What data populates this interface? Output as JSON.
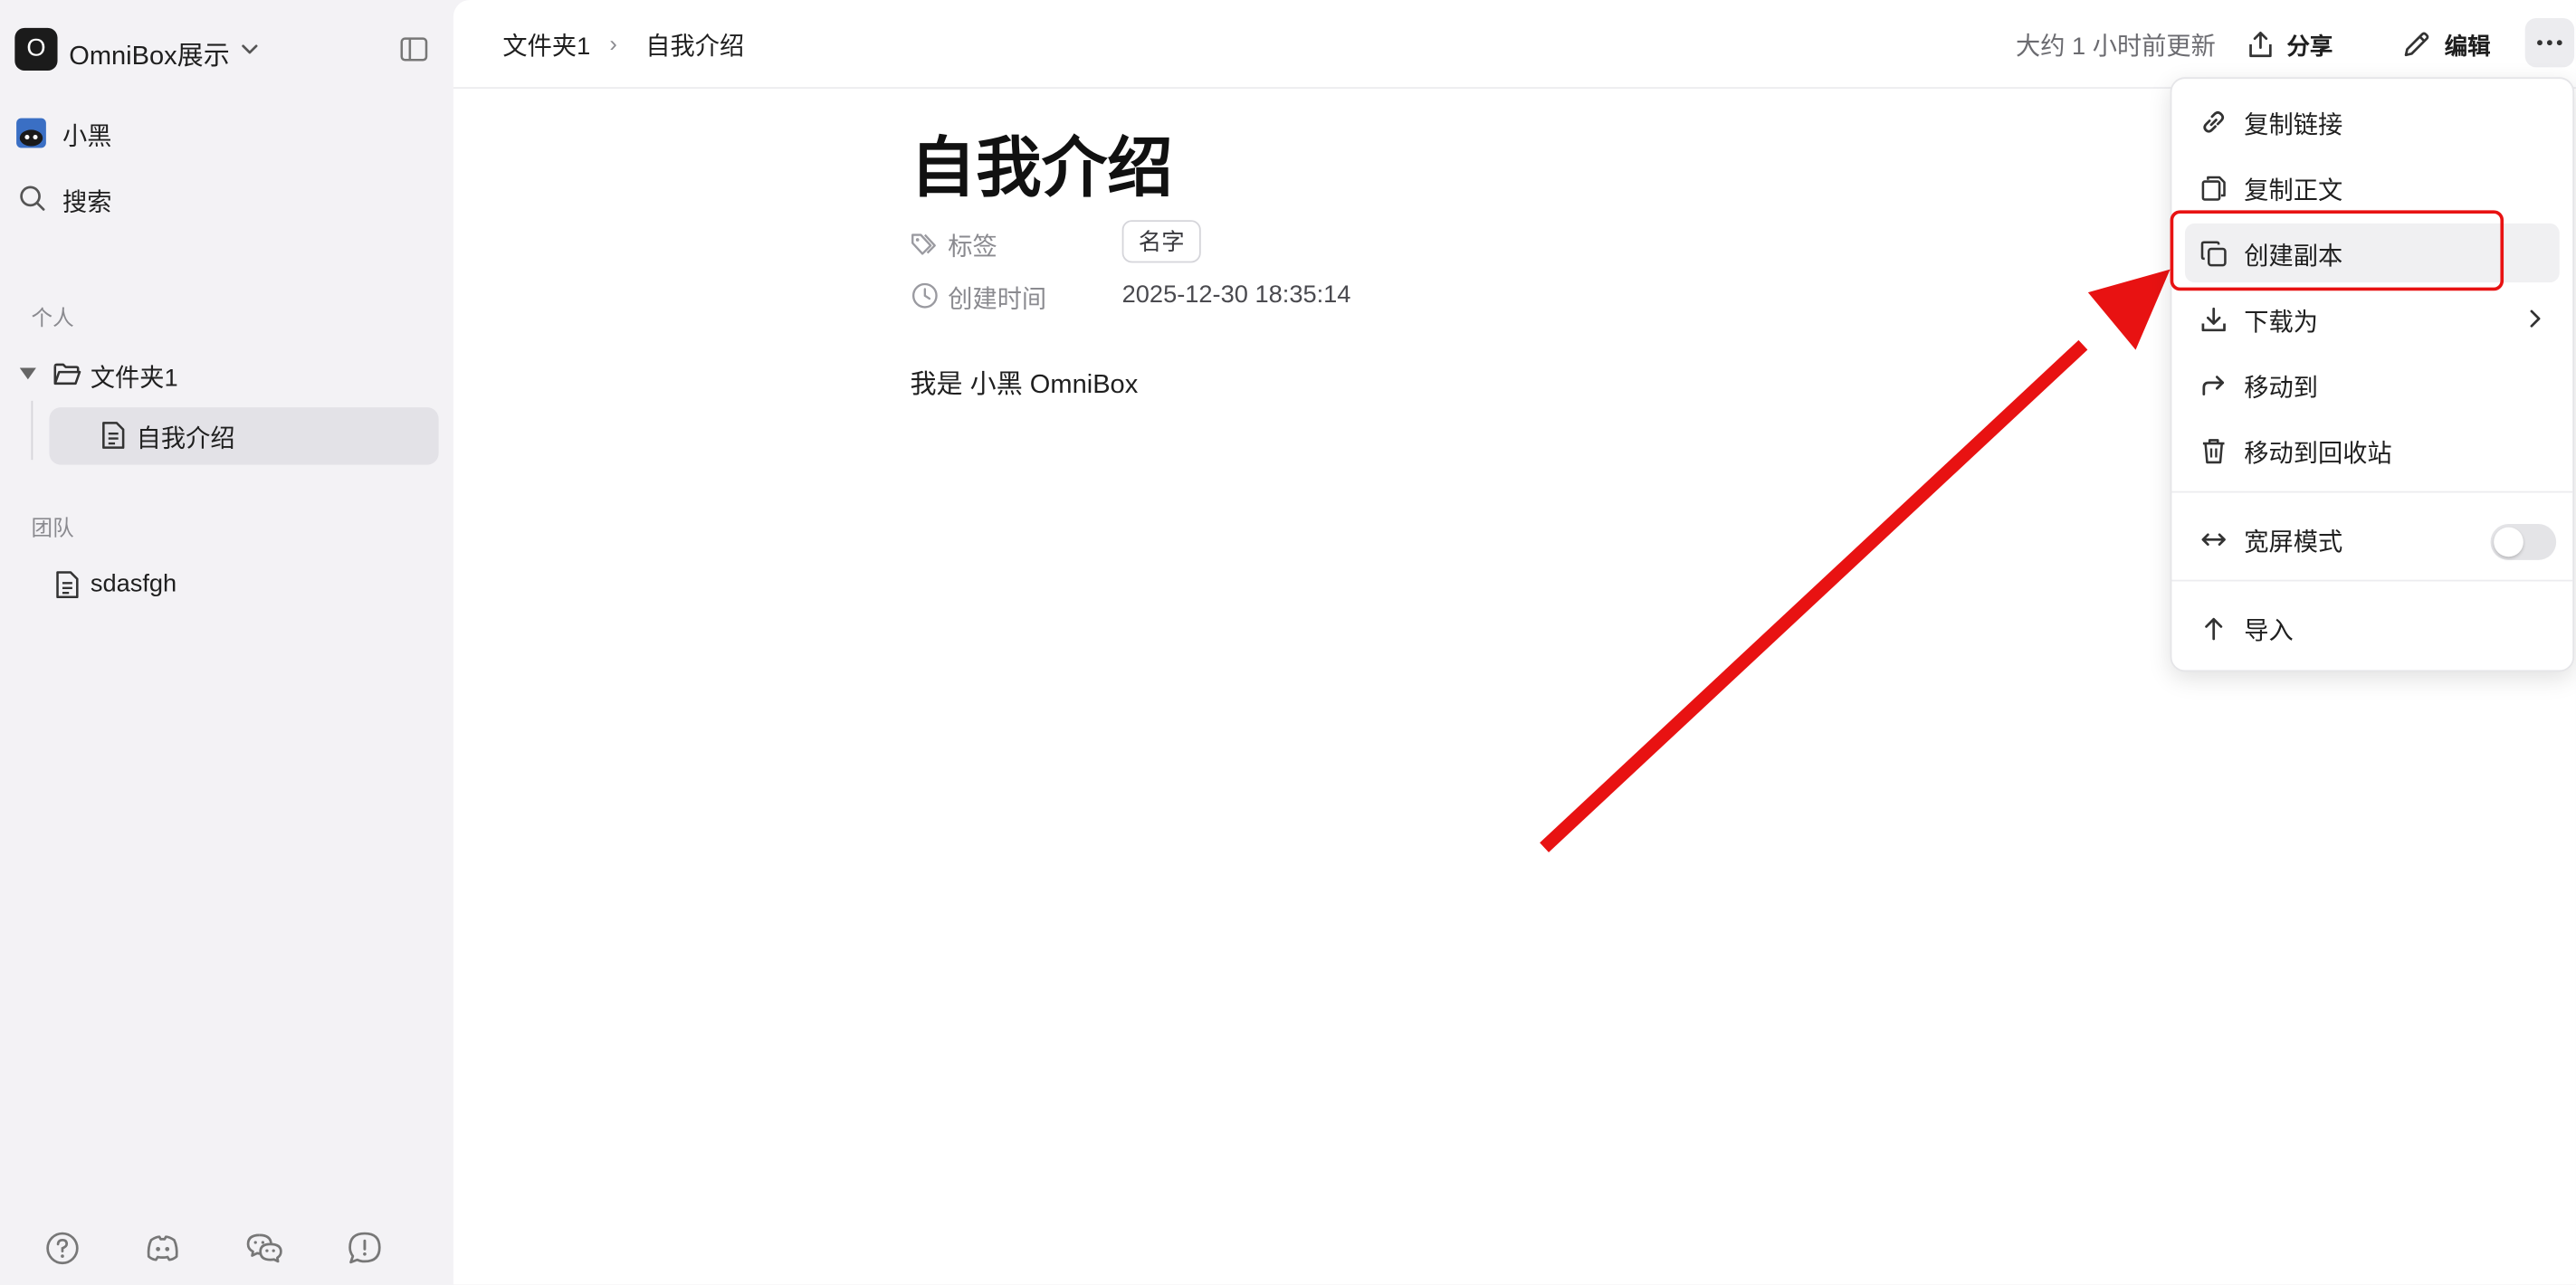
{
  "sidebar": {
    "workspace_initial": "O",
    "workspace_name": "OmniBox展示",
    "user_name": "小黑",
    "search_label": "搜索",
    "section_personal": "个人",
    "folder_name": "文件夹1",
    "active_doc": "自我介绍",
    "section_team": "团队",
    "team_doc": "sdasfgh",
    "footer_icons": [
      "help-icon",
      "discord-icon",
      "wechat-icon",
      "feedback-icon"
    ]
  },
  "topbar": {
    "breadcrumb_folder": "文件夹1",
    "breadcrumb_separator": "›",
    "breadcrumb_doc": "自我介绍",
    "updated_text": "大约 1 小时前更新",
    "share_label": "分享",
    "edit_label": "编辑"
  },
  "document": {
    "title": "自我介绍",
    "tags_label": "标签",
    "tag": "名字",
    "created_label": "创建时间",
    "created_value": "2025-12-30 18:35:14",
    "body": "我是 小黑 OmniBox"
  },
  "menu": {
    "copy_link": "复制链接",
    "copy_text": "复制正文",
    "duplicate": "创建副本",
    "download_as": "下载为",
    "move_to": "移动到",
    "move_to_trash": "移动到回收站",
    "wide_mode": "宽屏模式",
    "wide_mode_on": false,
    "import": "导入"
  },
  "colors": {
    "annotation": "#e81212",
    "sidebar_bg": "#f3f2f5",
    "active_item_bg": "#e3e2e7"
  }
}
